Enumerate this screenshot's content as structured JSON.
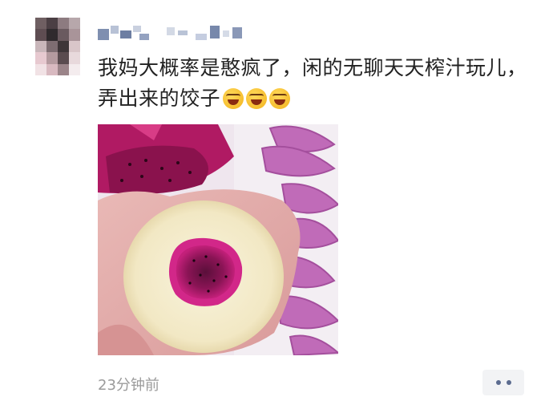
{
  "post": {
    "text": "我妈大概率是憨疯了，闲的无聊天天榨汁玩儿，弄出来的饺子",
    "emojis": [
      "grinning-squinting-face",
      "grinning-squinting-face",
      "grinning-squinting-face"
    ],
    "timestamp": "23分钟前"
  },
  "colors": {
    "text": "#222222",
    "timestamp": "#9b9b9b",
    "more_dots": "#5b6b8f",
    "more_bg": "#f2f3f5"
  }
}
